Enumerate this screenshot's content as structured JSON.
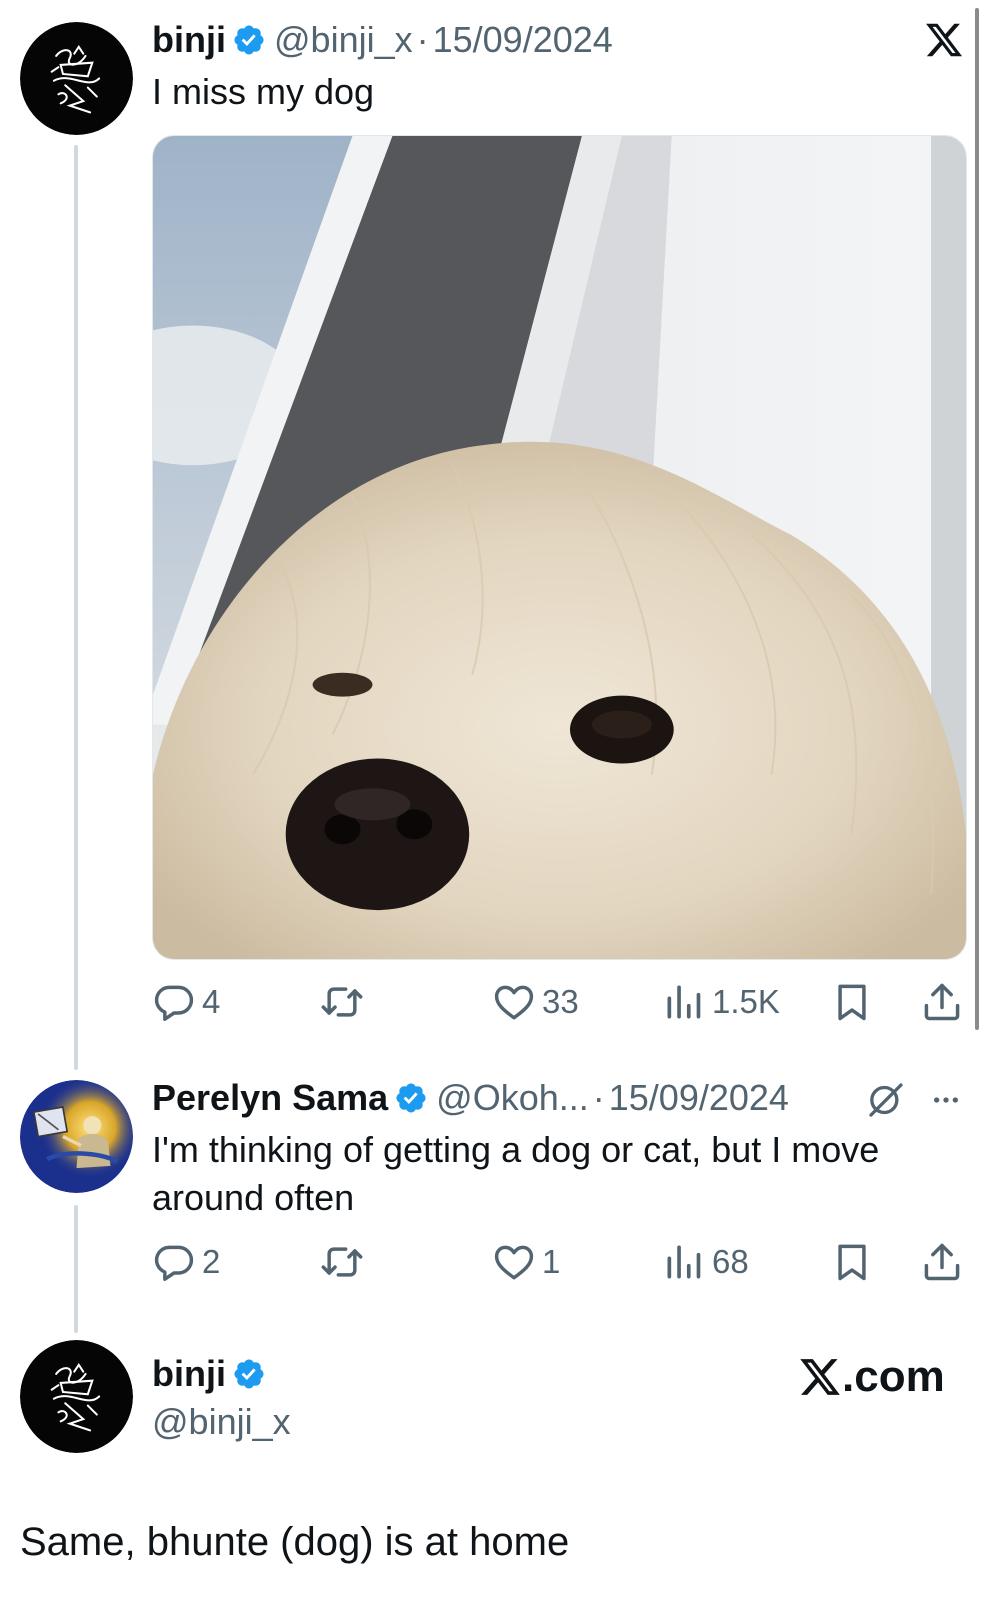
{
  "brand_color": "#1d9bf0",
  "muted_color": "#536471",
  "tweet1": {
    "name": "binji",
    "handle": "@binji_x",
    "separator": "·",
    "date": "15/09/2024",
    "text": "I miss my dog",
    "media_subject": "dog photo",
    "actions": {
      "replies": "4",
      "likes": "33",
      "views": "1.5K"
    }
  },
  "tweet2": {
    "name": "Perelyn Sama",
    "handle": "@Okoh...",
    "separator": "·",
    "date": "15/09/2024",
    "text_line1": "I'm thinking of getting a dog or cat, but I move",
    "text_line2": "around often",
    "actions": {
      "replies": "2",
      "likes": "1",
      "views": "68"
    }
  },
  "tweet3": {
    "name": "binji",
    "handle": "@binji_x",
    "text": "Same, bhunte (dog) is at home"
  },
  "watermark": {
    "suffix": ".com"
  },
  "icons": [
    "x-logo-icon",
    "verified-badge-icon",
    "reply-icon",
    "retweet-icon",
    "like-icon",
    "views-icon",
    "bookmark-icon",
    "share-icon",
    "grok-icon",
    "more-icon"
  ]
}
